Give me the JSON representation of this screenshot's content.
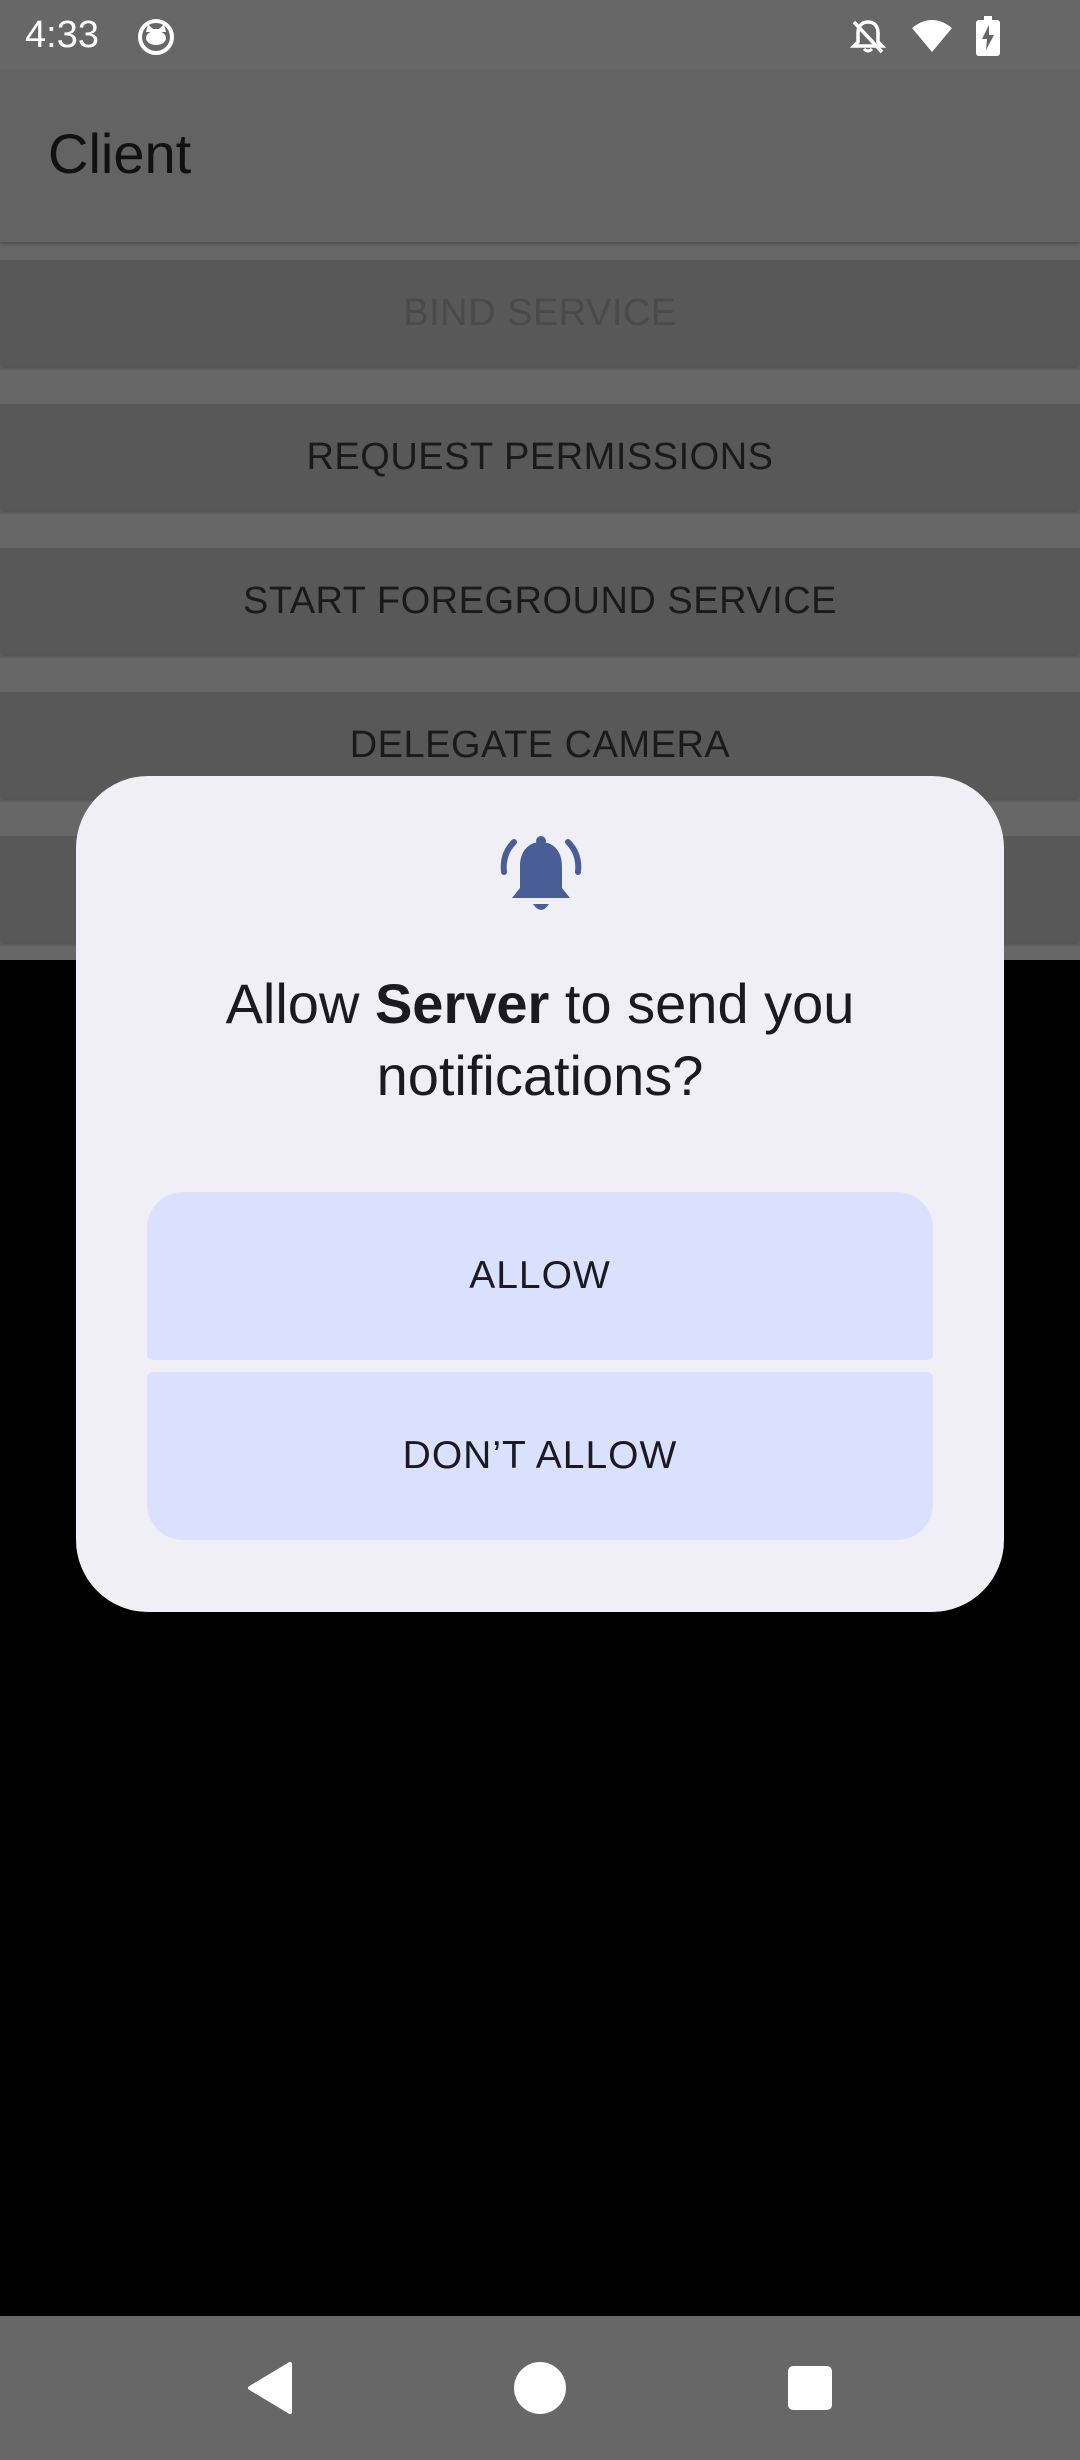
{
  "status_bar": {
    "time": "4:33",
    "icons": [
      "app-cat-icon",
      "notifications-off-icon",
      "wifi-icon",
      "battery-charging-icon"
    ]
  },
  "app": {
    "title": "Client",
    "buttons": [
      {
        "label": "BIND SERVICE",
        "enabled": false
      },
      {
        "label": "REQUEST PERMISSIONS",
        "enabled": true
      },
      {
        "label": "START FOREGROUND SERVICE",
        "enabled": true
      },
      {
        "label": "DELEGATE CAMERA",
        "enabled": true
      },
      {
        "label": "",
        "enabled": true
      }
    ]
  },
  "dialog": {
    "icon": "bell-ringing-icon",
    "title_prefix": "Allow ",
    "app_name": "Server",
    "title_suffix": " to send you notifications?",
    "allow_label": "ALLOW",
    "deny_label": "DON’T ALLOW"
  },
  "nav_bar": {
    "buttons": [
      "back-icon",
      "home-icon",
      "recents-icon"
    ]
  },
  "colors": {
    "scrim_app_background": "#676767",
    "dialog_background": "#f0eff6",
    "dialog_button": "#dae1fe",
    "bell_icon": "#4a5e96"
  }
}
